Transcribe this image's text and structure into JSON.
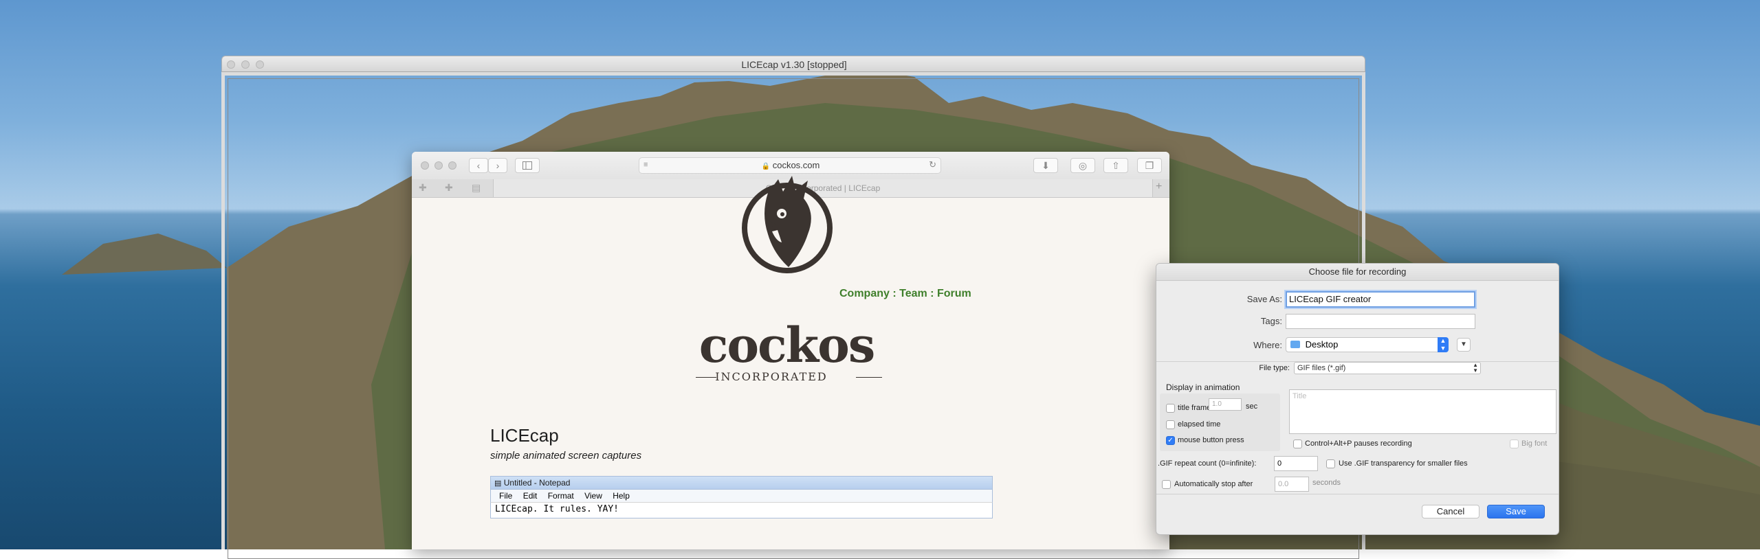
{
  "licecap_window": {
    "title": "LICEcap v1.30 [stopped]"
  },
  "safari": {
    "address": "cockos.com",
    "tab_title": "Cockos Incorporated | LICEcap",
    "page": {
      "nav_links": "Company : Team : Forum",
      "logo_wordmark": "cockos",
      "logo_sub": "INCORPORATED",
      "heading": "LICEcap",
      "subtitle": "simple animated screen captures",
      "notepad": {
        "title": "Untitled - Notepad",
        "menu": [
          "File",
          "Edit",
          "Format",
          "View",
          "Help"
        ],
        "body": "LICEcap. It rules. YAY!"
      }
    }
  },
  "dialog": {
    "title": "Choose file for recording",
    "save_as_label": "Save As:",
    "save_as_value": "LICEcap GIF creator",
    "tags_label": "Tags:",
    "where_label": "Where:",
    "where_value": "Desktop",
    "file_type_label": "File type:",
    "file_type_value": "GIF files (*.gif)",
    "display_group_label": "Display in animation",
    "title_frame_label": "title frame:",
    "title_frame_secs": "1.0",
    "sec_label": "sec",
    "elapsed_label": "elapsed time",
    "mouse_label": "mouse button press",
    "title_placeholder": "Title",
    "pause_label": "Control+Alt+P pauses recording",
    "big_font_label": "Big font",
    "repeat_label": ".GIF repeat count (0=infinite):",
    "repeat_value": "0",
    "transparency_label": "Use .GIF transparency for smaller files",
    "autostop_label": "Automatically stop after",
    "autostop_value": "0.0",
    "seconds_label": "seconds",
    "cancel_label": "Cancel",
    "save_label": "Save"
  }
}
